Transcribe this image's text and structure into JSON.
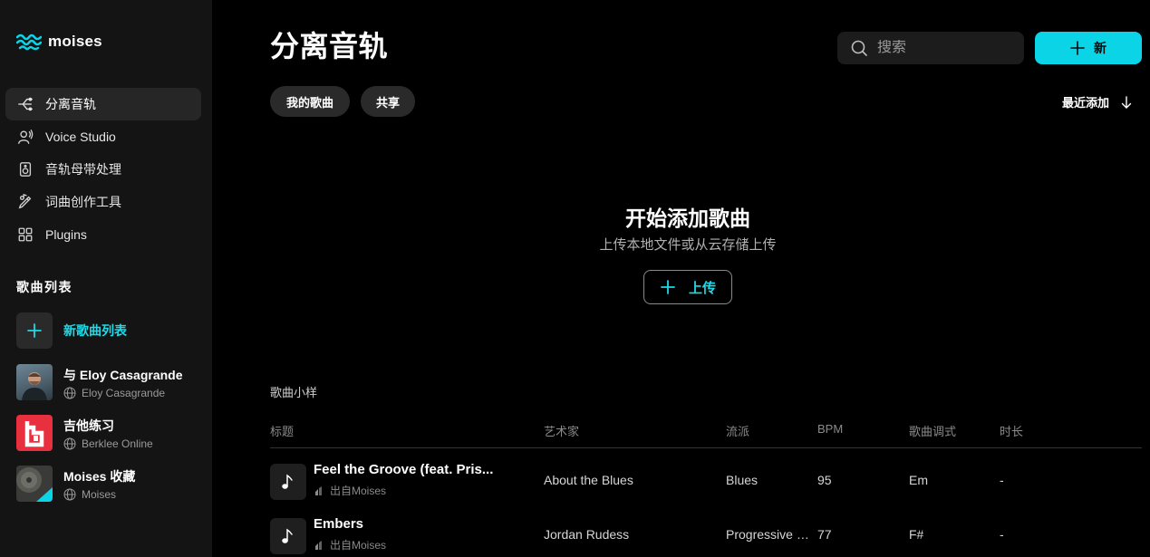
{
  "brand": {
    "name": "moises",
    "accent": "#0ad4e6"
  },
  "sidebar": {
    "nav": [
      {
        "label": "分离音轨",
        "icon": "split-icon"
      },
      {
        "label": "Voice Studio",
        "icon": "voice-icon"
      },
      {
        "label": "音轨母带处理",
        "icon": "speaker-icon"
      },
      {
        "label": "词曲创作工具",
        "icon": "songwriting-icon"
      },
      {
        "label": "Plugins",
        "icon": "grid-icon"
      }
    ],
    "playlists_heading": "歌曲列表",
    "new_playlist_label": "新歌曲列表",
    "playlists": [
      {
        "title": "与 Eloy Casagrande",
        "owner": "Eloy Casagrande"
      },
      {
        "title": "吉他练习",
        "owner": "Berklee Online"
      },
      {
        "title": "Moises 收藏",
        "owner": "Moises"
      }
    ]
  },
  "header": {
    "title": "分离音轨",
    "search_placeholder": "搜索",
    "new_label": "新"
  },
  "filters": {
    "mine": "我的歌曲",
    "shared": "共享",
    "sort_label": "最近添加"
  },
  "empty": {
    "title": "开始添加歌曲",
    "subtitle": "上传本地文件或从云存储上传",
    "upload_label": "上传"
  },
  "samples": {
    "label": "歌曲小样",
    "columns": {
      "title": "标题",
      "artist": "艺术家",
      "genre": "流派",
      "bpm": "BPM",
      "key": "歌曲调式",
      "duration": "时长"
    },
    "rows": [
      {
        "title": "Feel the Groove (feat. Pris...",
        "source": "出自Moises",
        "artist": "About the Blues",
        "genre": "Blues",
        "bpm": "95",
        "key": "Em",
        "duration": "-"
      },
      {
        "title": "Embers",
        "source": "出自Moises",
        "artist": "Jordan Rudess",
        "genre": "Progressive R...",
        "bpm": "77",
        "key": "F#",
        "duration": "-"
      }
    ]
  }
}
